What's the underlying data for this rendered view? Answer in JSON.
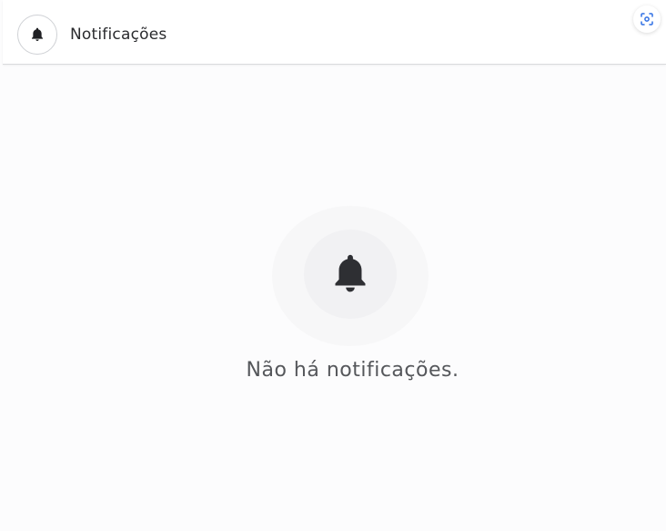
{
  "header": {
    "title": "Notificações",
    "icon": "bell-icon",
    "action_icon": "scan-icon"
  },
  "empty_state": {
    "icon": "bell-icon",
    "message": "Não há notificações."
  },
  "colors": {
    "accent": "#2f6fe4",
    "icon_dark": "#2e2f33",
    "text": "#55575b"
  }
}
